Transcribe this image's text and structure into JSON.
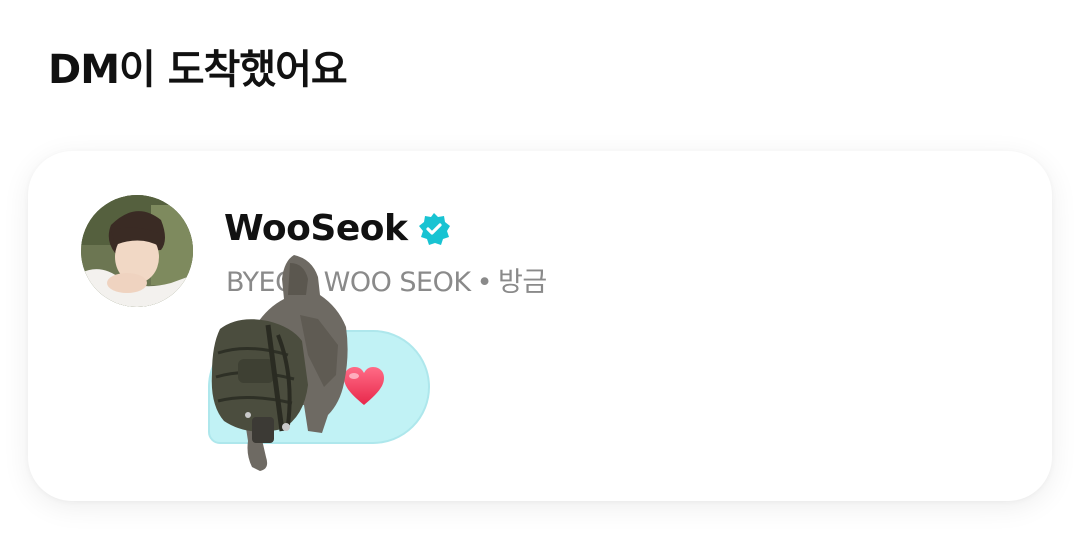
{
  "header": {
    "title": "DM이 도착했어요"
  },
  "dm_card": {
    "sender_name": "WooSeok",
    "verified_icon": "verified-badge-icon",
    "subtitle_name": "BYEON WOO SEOK",
    "subtitle_separator": "•",
    "subtitle_time": "방금",
    "message_emoji": "heart-emoji",
    "sticker": "backpack-sticker"
  },
  "colors": {
    "verified_badge": "#18c3d2",
    "bubble_fill": "#c1f2f5",
    "bubble_border": "#aee7ec",
    "heart": "#f0415f",
    "subtitle_text": "#8a8a8a"
  }
}
